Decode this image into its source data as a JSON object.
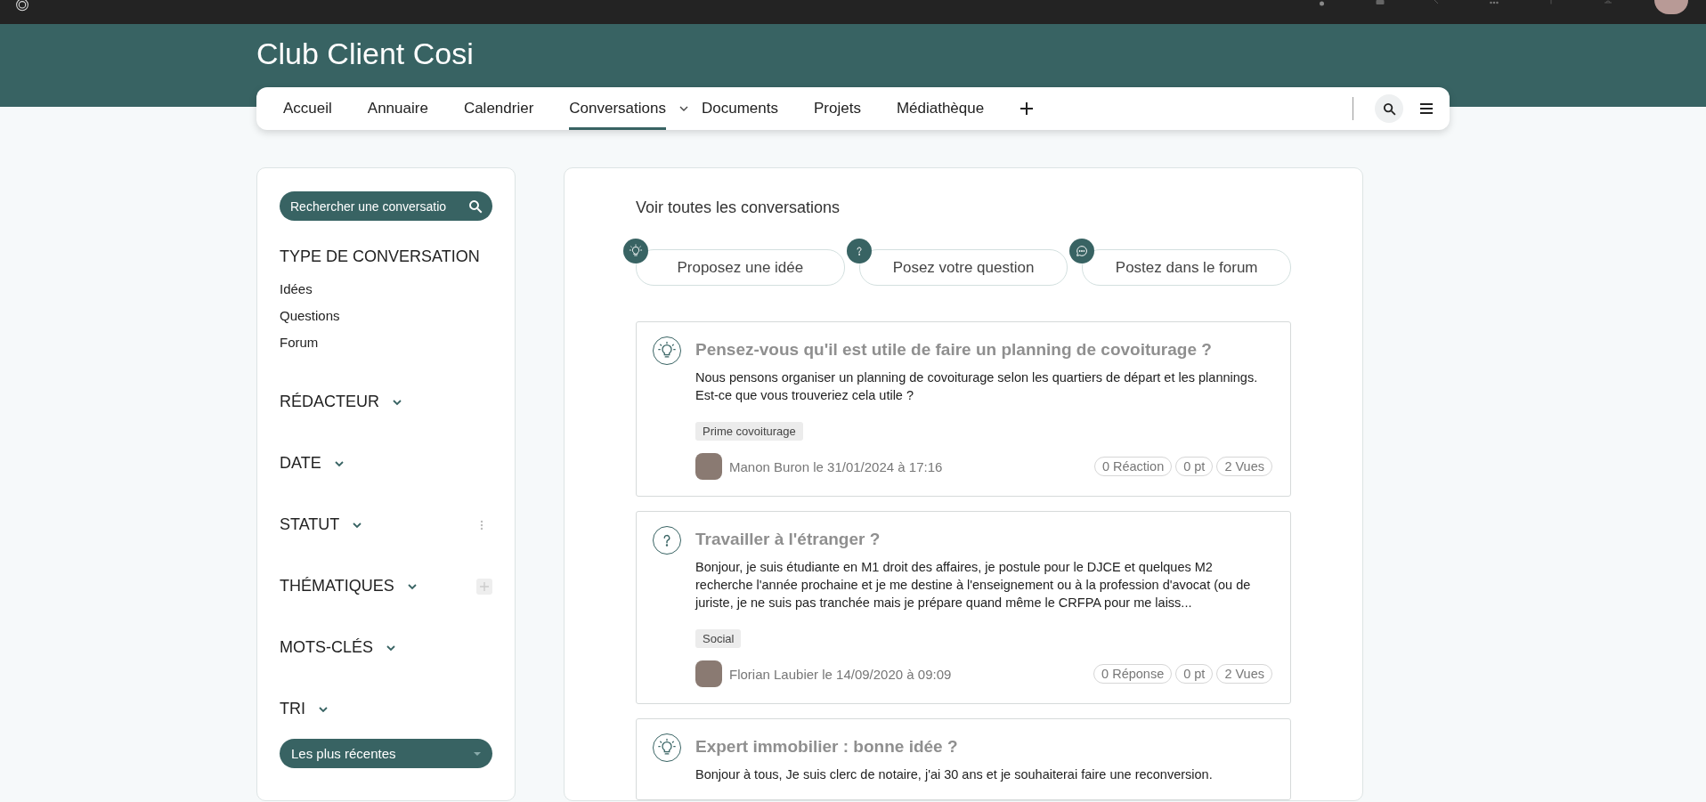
{
  "site": {
    "title": "Club Client Cosi"
  },
  "nav": {
    "items": [
      {
        "label": "Accueil",
        "selected": false,
        "has_menu": false
      },
      {
        "label": "Annuaire",
        "selected": false,
        "has_menu": false
      },
      {
        "label": "Calendrier",
        "selected": false,
        "has_menu": false
      },
      {
        "label": "Conversations",
        "selected": true,
        "has_menu": true
      },
      {
        "label": "Documents",
        "selected": false,
        "has_menu": false
      },
      {
        "label": "Projets",
        "selected": false,
        "has_menu": false
      },
      {
        "label": "Médiathèque",
        "selected": false,
        "has_menu": false
      }
    ]
  },
  "sidebar": {
    "search": {
      "placeholder": "Rechercher une conversatio"
    },
    "sections": [
      {
        "kind": "list",
        "title": "TYPE DE CONVERSATION",
        "items": [
          "Idées",
          "Questions",
          "Forum"
        ]
      },
      {
        "kind": "dropdown",
        "title": "RÉDACTEUR"
      },
      {
        "kind": "dropdown",
        "title": "DATE"
      },
      {
        "kind": "dropdown",
        "title": "STATUT",
        "more_menu": true
      },
      {
        "kind": "dropdown",
        "title": "THÉMATIQUES",
        "add_button": true
      },
      {
        "kind": "dropdown",
        "title": "MOTS-CLÉS"
      },
      {
        "kind": "dropdown",
        "title": "TRI",
        "select": "Les plus récentes"
      }
    ]
  },
  "main": {
    "heading": "Voir toutes les conversations",
    "actions": [
      {
        "kind": "idea",
        "label": "Proposez une idée"
      },
      {
        "kind": "question",
        "label": "Posez votre question"
      },
      {
        "kind": "forum",
        "label": "Postez dans le forum"
      }
    ],
    "conversations": [
      {
        "kind": "idea",
        "title": "Pensez-vous qu'il est utile de faire un planning de covoiturage ?",
        "excerpt": "Nous pensons organiser un planning de covoiturage selon les quartiers de départ et les plannings. Est-ce que vous trouveriez cela utile ?",
        "tag": "Prime covoiturage",
        "author": "Manon Buron le 31/01/2024 à 17:16",
        "stats": [
          "0 Réaction",
          "0 pt",
          "2 Vues"
        ]
      },
      {
        "kind": "question",
        "title": "Travailler à l'étranger ?",
        "excerpt": "Bonjour, je suis étudiante en M1 droit des affaires, je postule pour le DJCE et quelques M2 recherche l'année prochaine et je me destine à l'enseignement ou à la profession d'avocat (ou de juriste, je ne suis pas tranchée mais je prépare quand même le CRFPA pour me laiss...",
        "tag": "Social",
        "author": "Florian Laubier le 14/09/2020 à 09:09",
        "stats": [
          "0 Réponse",
          "0 pt",
          "2 Vues"
        ]
      },
      {
        "kind": "idea",
        "title": "Expert immobilier : bonne idée ?",
        "excerpt": "Bonjour à tous, Je suis clerc de notaire, j'ai 30 ans et je souhaiterai faire une reconversion."
      }
    ]
  }
}
